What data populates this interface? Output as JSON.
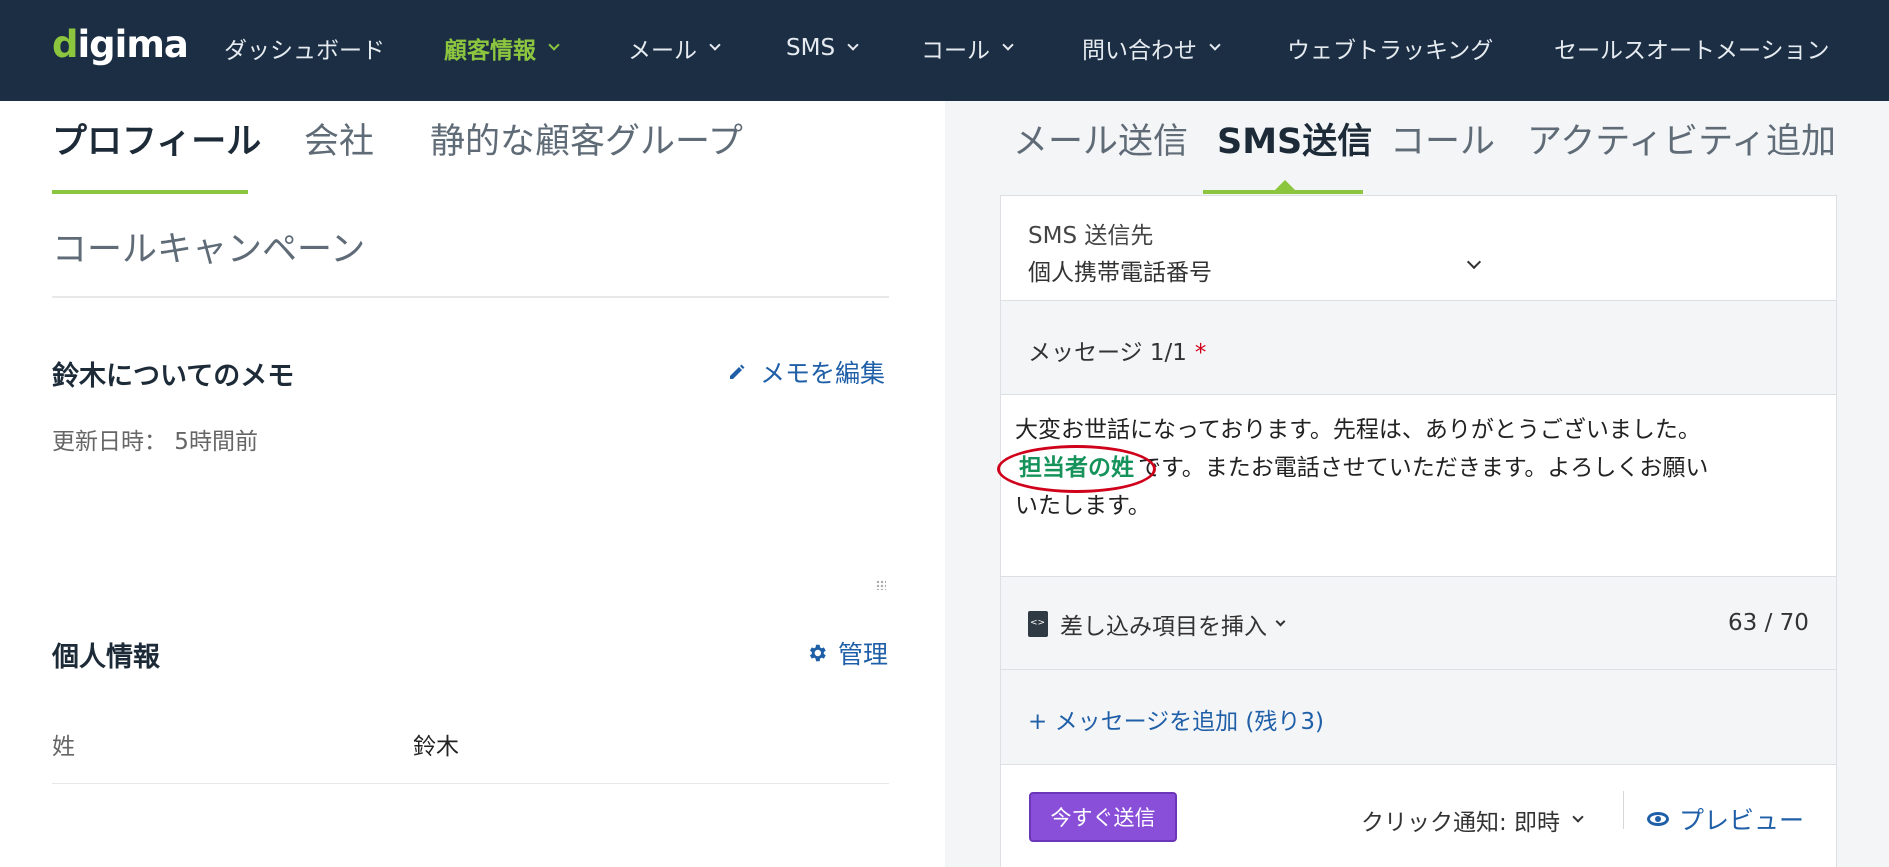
{
  "nav": {
    "logo_prefix": "d",
    "logo_rest": "igima",
    "items": [
      {
        "label": "ダッシュボード"
      },
      {
        "label": "顧客情報"
      },
      {
        "label": "メール"
      },
      {
        "label": "SMS"
      },
      {
        "label": "コール"
      },
      {
        "label": "問い合わせ"
      },
      {
        "label": "ウェブトラッキング"
      },
      {
        "label": "セールスオートメーション"
      }
    ],
    "active_color": "#8cc63f",
    "background": "#1b2e44"
  },
  "left": {
    "tabs": [
      "プロフィール",
      "会社",
      "静的な顧客グループ"
    ],
    "call_campaign": "コールキャンペーン",
    "memo": {
      "title": "鈴木についてのメモ",
      "edit_label": "メモを編集",
      "updated": "更新日時： 5時間前"
    },
    "personal": {
      "title": "個人情報",
      "manage_label": "管理",
      "field_label": "姓",
      "field_value": "鈴木"
    }
  },
  "right": {
    "tabs": [
      "メール送信",
      "SMS送信",
      "コール",
      "アクティビティ追加"
    ],
    "sms_to_label": "SMS 送信先",
    "sms_to_value": "個人携帯電話番号",
    "message_label": "メッセージ 1/1",
    "required_mark": "*",
    "message_line1": "大変お世話になっております。先程は、ありがとうございました。",
    "merge_tag": "担当者の姓",
    "message_line2": "です。またお電話させていただきます。よろしくお願い",
    "message_line3": "いたします。",
    "insert_merge_label": "差し込み項目を挿入",
    "char_count": "63 / 70",
    "add_message": "+ メッセージを追加 (残り3)",
    "send_now": "今すぐ送信",
    "click_notify": "クリック通知: 即時",
    "preview": "プレビュー"
  }
}
